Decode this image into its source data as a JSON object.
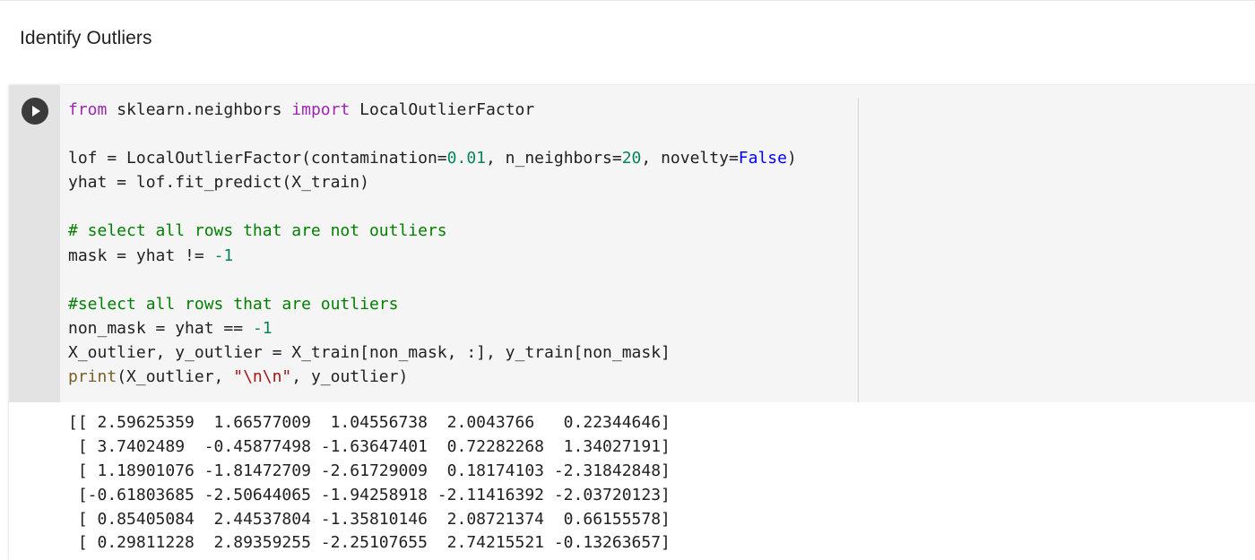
{
  "section": {
    "title": "Identify Outliers"
  },
  "cell": {
    "run_button_label": "play-icon",
    "code": {
      "line1": {
        "kw_from": "from",
        "module": " sklearn.neighbors ",
        "kw_import": "import",
        "name": " LocalOutlierFactor"
      },
      "line3": {
        "a": "lof = LocalOutlierFactor(contamination=",
        "n1": "0.01",
        "b": ", n_neighbors=",
        "n2": "20",
        "c": ", novelty=",
        "bool": "False",
        "d": ")"
      },
      "line4": "yhat = lof.fit_predict(X_train)",
      "line6": "# select all rows that are not outliers",
      "line7": {
        "a": "mask = yhat != ",
        "n": "-1"
      },
      "line9": "#select all rows that are outliers",
      "line10": {
        "a": "non_mask = yhat == ",
        "n": "-1"
      },
      "line11": "X_outlier, y_outlier = X_train[non_mask, :], y_train[non_mask]",
      "line12": {
        "fn": "print",
        "a": "(X_outlier, ",
        "str": "\"\\n\\n\"",
        "b": ", y_outlier)"
      }
    },
    "output": [
      "[[ 2.59625359  1.66577009  1.04556738  2.0043766   0.22344646]",
      " [ 3.7402489  -0.45877498 -1.63647401  0.72282268  1.34027191]",
      " [ 1.18901076 -1.81472709 -2.61729009  0.18174103 -2.31842848]",
      " [-0.61803685 -2.50644065 -1.94258918 -2.11416392 -2.03720123]",
      " [ 0.85405084  2.44537804 -1.35810146  2.08721374  0.66155578]",
      " [ 0.29811228  2.89359255 -2.25107655  2.74215521 -0.13263657]"
    ]
  },
  "colors": {
    "keyword": "#9c27b0",
    "number": "#098658",
    "boolean": "#0000ff",
    "comment": "#008000",
    "function": "#795e26",
    "string": "#a31515",
    "code_background": "#f5f5f5",
    "gutter_background": "#e3e3e3"
  }
}
